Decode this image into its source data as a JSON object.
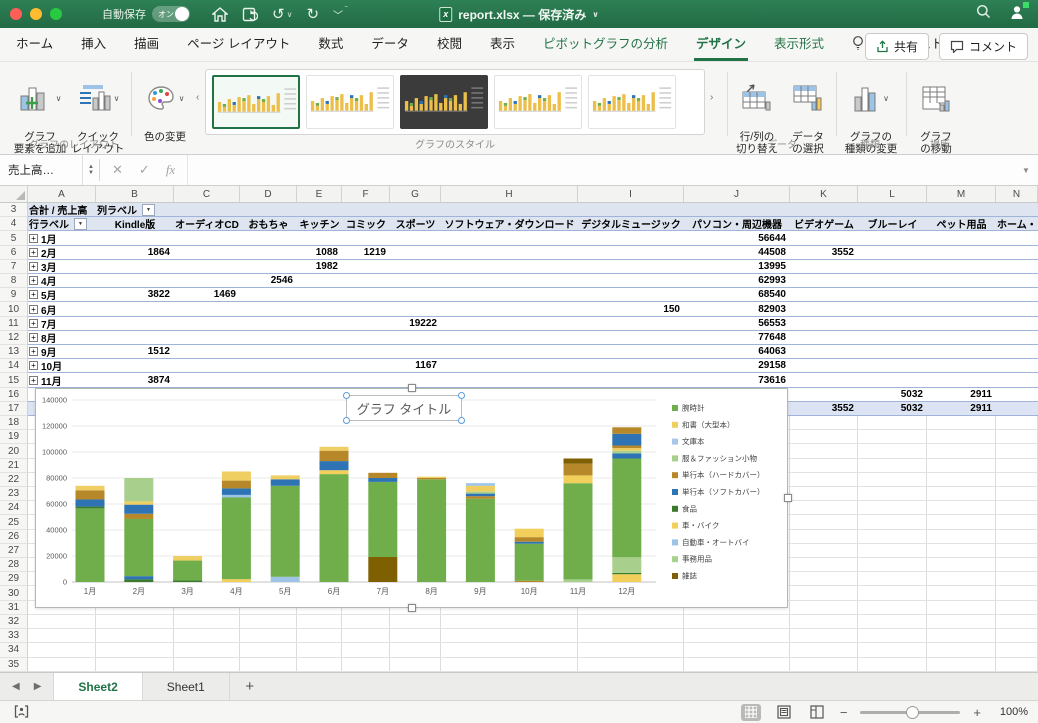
{
  "titlebar": {
    "autosave_label": "自動保存",
    "autosave_state": "オン",
    "doc_title": "report.xlsx — 保存済み"
  },
  "tabs": [
    {
      "label": "ホーム"
    },
    {
      "label": "挿入"
    },
    {
      "label": "描画"
    },
    {
      "label": "ページ レイアウト"
    },
    {
      "label": "数式"
    },
    {
      "label": "データ"
    },
    {
      "label": "校閲"
    },
    {
      "label": "表示"
    },
    {
      "label": "ピボットグラフの分析",
      "contextual": true
    },
    {
      "label": "デザイン",
      "contextual": true,
      "active": true
    },
    {
      "label": "表示形式",
      "contextual": true
    },
    {
      "label": "操作アシスト",
      "assistant": true
    }
  ],
  "tab_actions": {
    "share": "共有",
    "comments": "コメント"
  },
  "ribbon": {
    "add_element": [
      "グラフ",
      "要素を追加"
    ],
    "quick_layout": [
      "クイック",
      "レイアウト"
    ],
    "change_colors": [
      "色の変更"
    ],
    "layout_group": "グラフのレイアウト",
    "styles_group": "グラフのスタイル",
    "switch_rowcol": [
      "行/列の",
      "切り替え"
    ],
    "select_data": [
      "データ",
      "の選択"
    ],
    "change_type": [
      "グラフの",
      "種類の変更"
    ],
    "move_chart": [
      "グラフ",
      "の移動"
    ],
    "data_group": "データ",
    "type_group": "種類",
    "location_group": "場所",
    "styles_gallery": [
      {
        "selected": true,
        "dark": false
      },
      {
        "selected": false,
        "dark": false
      },
      {
        "selected": false,
        "dark": true
      },
      {
        "selected": false,
        "dark": false
      },
      {
        "selected": false,
        "dark": false
      }
    ]
  },
  "formula_bar": {
    "name_box": "売上高…"
  },
  "grid": {
    "columns": [
      {
        "letter": "A",
        "w": 68
      },
      {
        "letter": "B",
        "w": 78
      },
      {
        "letter": "C",
        "w": 66
      },
      {
        "letter": "D",
        "w": 57
      },
      {
        "letter": "E",
        "w": 45
      },
      {
        "letter": "F",
        "w": 48
      },
      {
        "letter": "G",
        "w": 51
      },
      {
        "letter": "H",
        "w": 137
      },
      {
        "letter": "I",
        "w": 106
      },
      {
        "letter": "J",
        "w": 106
      },
      {
        "letter": "K",
        "w": 68
      },
      {
        "letter": "L",
        "w": 69
      },
      {
        "letter": "M",
        "w": 69
      },
      {
        "letter": "N",
        "w": 42
      }
    ],
    "row_start": 3,
    "row_end": 35,
    "pivot_fill_rows": [
      3,
      4
    ],
    "pivot_end_row": 17,
    "highlight_row": 17,
    "rows": [
      {
        "n": 3,
        "cells": [
          {
            "c": "A",
            "t": "合計 / 売上高",
            "a": "l"
          },
          {
            "c": "B",
            "t": "列ラベル",
            "a": "l",
            "f": true
          }
        ]
      },
      {
        "n": 4,
        "cells": [
          {
            "c": "A",
            "t": "行ラベル",
            "a": "l",
            "f": true
          },
          {
            "c": "B",
            "t": "Kindle版",
            "a": "c"
          },
          {
            "c": "C",
            "t": "オーディオCD",
            "a": "c"
          },
          {
            "c": "D",
            "t": "おもちゃ",
            "a": "c"
          },
          {
            "c": "E",
            "t": "キッチン",
            "a": "c"
          },
          {
            "c": "F",
            "t": "コミック",
            "a": "c"
          },
          {
            "c": "G",
            "t": "スポーツ",
            "a": "c"
          },
          {
            "c": "H",
            "t": "ソフトウェア・ダウンロード",
            "a": "c"
          },
          {
            "c": "I",
            "t": "デジタルミュージック",
            "a": "c"
          },
          {
            "c": "J",
            "t": "パソコン・周辺機器",
            "a": "c"
          },
          {
            "c": "K",
            "t": "ビデオゲーム",
            "a": "c"
          },
          {
            "c": "L",
            "t": "ブルーレイ",
            "a": "c"
          },
          {
            "c": "M",
            "t": "ペット用品",
            "a": "c"
          },
          {
            "c": "N",
            "t": "ホーム・キ",
            "a": "l"
          }
        ]
      },
      {
        "n": 5,
        "cells": [
          {
            "c": "A",
            "t": "1月",
            "a": "l",
            "e": true
          },
          {
            "c": "J",
            "t": "56644",
            "a": "r"
          }
        ]
      },
      {
        "n": 6,
        "cells": [
          {
            "c": "A",
            "t": "2月",
            "a": "l",
            "e": true
          },
          {
            "c": "B",
            "t": "1864",
            "a": "r"
          },
          {
            "c": "E",
            "t": "1088",
            "a": "r"
          },
          {
            "c": "F",
            "t": "1219",
            "a": "r"
          },
          {
            "c": "J",
            "t": "44508",
            "a": "r"
          },
          {
            "c": "K",
            "t": "3552",
            "a": "r"
          }
        ]
      },
      {
        "n": 7,
        "cells": [
          {
            "c": "A",
            "t": "3月",
            "a": "l",
            "e": true
          },
          {
            "c": "E",
            "t": "1982",
            "a": "r"
          },
          {
            "c": "J",
            "t": "13995",
            "a": "r"
          }
        ]
      },
      {
        "n": 8,
        "cells": [
          {
            "c": "A",
            "t": "4月",
            "a": "l",
            "e": true
          },
          {
            "c": "D",
            "t": "2546",
            "a": "r"
          },
          {
            "c": "J",
            "t": "62993",
            "a": "r"
          }
        ]
      },
      {
        "n": 9,
        "cells": [
          {
            "c": "A",
            "t": "5月",
            "a": "l",
            "e": true
          },
          {
            "c": "B",
            "t": "3822",
            "a": "r"
          },
          {
            "c": "C",
            "t": "1469",
            "a": "r"
          },
          {
            "c": "J",
            "t": "68540",
            "a": "r"
          }
        ]
      },
      {
        "n": 10,
        "cells": [
          {
            "c": "A",
            "t": "6月",
            "a": "l",
            "e": true
          },
          {
            "c": "I",
            "t": "150",
            "a": "r"
          },
          {
            "c": "J",
            "t": "82903",
            "a": "r"
          }
        ]
      },
      {
        "n": 11,
        "cells": [
          {
            "c": "A",
            "t": "7月",
            "a": "l",
            "e": true
          },
          {
            "c": "G",
            "t": "19222",
            "a": "r"
          },
          {
            "c": "J",
            "t": "56553",
            "a": "r"
          }
        ]
      },
      {
        "n": 12,
        "cells": [
          {
            "c": "A",
            "t": "8月",
            "a": "l",
            "e": true
          },
          {
            "c": "J",
            "t": "77648",
            "a": "r"
          }
        ]
      },
      {
        "n": 13,
        "cells": [
          {
            "c": "A",
            "t": "9月",
            "a": "l",
            "e": true
          },
          {
            "c": "B",
            "t": "1512",
            "a": "r"
          },
          {
            "c": "J",
            "t": "64063",
            "a": "r"
          }
        ]
      },
      {
        "n": 14,
        "cells": [
          {
            "c": "A",
            "t": "10月",
            "a": "l",
            "e": true
          },
          {
            "c": "G",
            "t": "1167",
            "a": "r"
          },
          {
            "c": "J",
            "t": "29158",
            "a": "r"
          }
        ]
      },
      {
        "n": 15,
        "cells": [
          {
            "c": "A",
            "t": "11月",
            "a": "l",
            "e": true
          },
          {
            "c": "B",
            "t": "3874",
            "a": "r"
          },
          {
            "c": "J",
            "t": "73616",
            "a": "r"
          }
        ]
      },
      {
        "n": 16,
        "cells": [
          {
            "c": "L",
            "t": "5032",
            "a": "r"
          },
          {
            "c": "M",
            "t": "2911",
            "a": "r"
          }
        ]
      },
      {
        "n": 17,
        "cells": [
          {
            "c": "K",
            "t": "3552",
            "a": "r"
          },
          {
            "c": "L",
            "t": "5032",
            "a": "r"
          },
          {
            "c": "M",
            "t": "2911",
            "a": "r"
          }
        ]
      }
    ]
  },
  "chart_data": {
    "type": "bar",
    "stacked": true,
    "title": "グラフ タイトル",
    "categories": [
      "1月",
      "2月",
      "3月",
      "4月",
      "5月",
      "6月",
      "7月",
      "8月",
      "9月",
      "10月",
      "11月",
      "12月"
    ],
    "ylim": [
      0,
      140000
    ],
    "ytick_step": 20000,
    "grid": true,
    "legend_position": "right",
    "series": [
      {
        "name": "腕時計",
        "color": "#6FAE4B"
      },
      {
        "name": "和書（大型本）",
        "color": "#EFCE62"
      },
      {
        "name": "文庫本",
        "color": "#A7C6E8"
      },
      {
        "name": "服＆ファッション小物",
        "color": "#A9CF8C"
      },
      {
        "name": "単行本（ハードカバー）",
        "color": "#B6882A"
      },
      {
        "name": "単行本（ソフトカバー）",
        "color": "#2E74B5"
      },
      {
        "name": "食品",
        "color": "#3A7A2A"
      },
      {
        "name": "車・バイク",
        "color": "#F2CE5A"
      },
      {
        "name": "自動車・オートバイ",
        "color": "#9DC3E6"
      },
      {
        "name": "事務用品",
        "color": "#A9D18E"
      },
      {
        "name": "雑誌",
        "color": "#7F6000"
      }
    ],
    "stacks": [
      [
        [
          0,
          56644
        ],
        [
          6,
          1356
        ],
        [
          5,
          5500
        ],
        [
          4,
          7000
        ],
        [
          1,
          3500
        ]
      ],
      [
        [
          6,
          2000
        ],
        [
          5,
          2500
        ],
        [
          0,
          44000
        ],
        [
          4,
          4000
        ],
        [
          5,
          7000
        ],
        [
          1,
          2500
        ],
        [
          3,
          18000
        ]
      ],
      [
        [
          6,
          1200
        ],
        [
          0,
          15300
        ],
        [
          1,
          3500
        ]
      ],
      [
        [
          7,
          2200
        ],
        [
          0,
          62800
        ],
        [
          8,
          2000
        ],
        [
          5,
          5000
        ],
        [
          4,
          6000
        ],
        [
          1,
          7000
        ]
      ],
      [
        [
          8,
          4000
        ],
        [
          0,
          70000
        ],
        [
          5,
          5000
        ],
        [
          1,
          3000
        ]
      ],
      [
        [
          0,
          83000
        ],
        [
          7,
          3000
        ],
        [
          5,
          7000
        ],
        [
          4,
          8000
        ],
        [
          1,
          3000
        ]
      ],
      [
        [
          10,
          19222
        ],
        [
          0,
          57778
        ],
        [
          5,
          3000
        ],
        [
          4,
          4000
        ]
      ],
      [
        [
          0,
          79000
        ],
        [
          4,
          1000
        ],
        [
          1,
          1000
        ]
      ],
      [
        [
          0,
          64000
        ],
        [
          4,
          2000
        ],
        [
          5,
          2000
        ],
        [
          9,
          1500
        ],
        [
          1,
          4500
        ],
        [
          8,
          2000
        ]
      ],
      [
        [
          4,
          1000
        ],
        [
          0,
          28500
        ],
        [
          5,
          1500
        ],
        [
          4,
          3500
        ],
        [
          7,
          6500
        ]
      ],
      [
        [
          9,
          2000
        ],
        [
          0,
          74000
        ],
        [
          7,
          6000
        ],
        [
          4,
          9000
        ],
        [
          10,
          4000
        ]
      ],
      [
        [
          7,
          6000
        ],
        [
          6,
          1000
        ],
        [
          3,
          12000
        ],
        [
          0,
          76000
        ],
        [
          5,
          4000
        ],
        [
          9,
          2000
        ],
        [
          1,
          2000
        ],
        [
          4,
          2000
        ],
        [
          5,
          9000
        ],
        [
          4,
          5000
        ]
      ]
    ],
    "totals_estimated": [
      74000,
      80000,
      20000,
      85000,
      82000,
      104000,
      84000,
      81000,
      76000,
      41000,
      95000,
      119000
    ]
  },
  "sheet_tabs": [
    {
      "label": "Sheet2",
      "active": true
    },
    {
      "label": "Sheet1",
      "active": false
    }
  ],
  "status_bar": {
    "zoom": "100%"
  }
}
